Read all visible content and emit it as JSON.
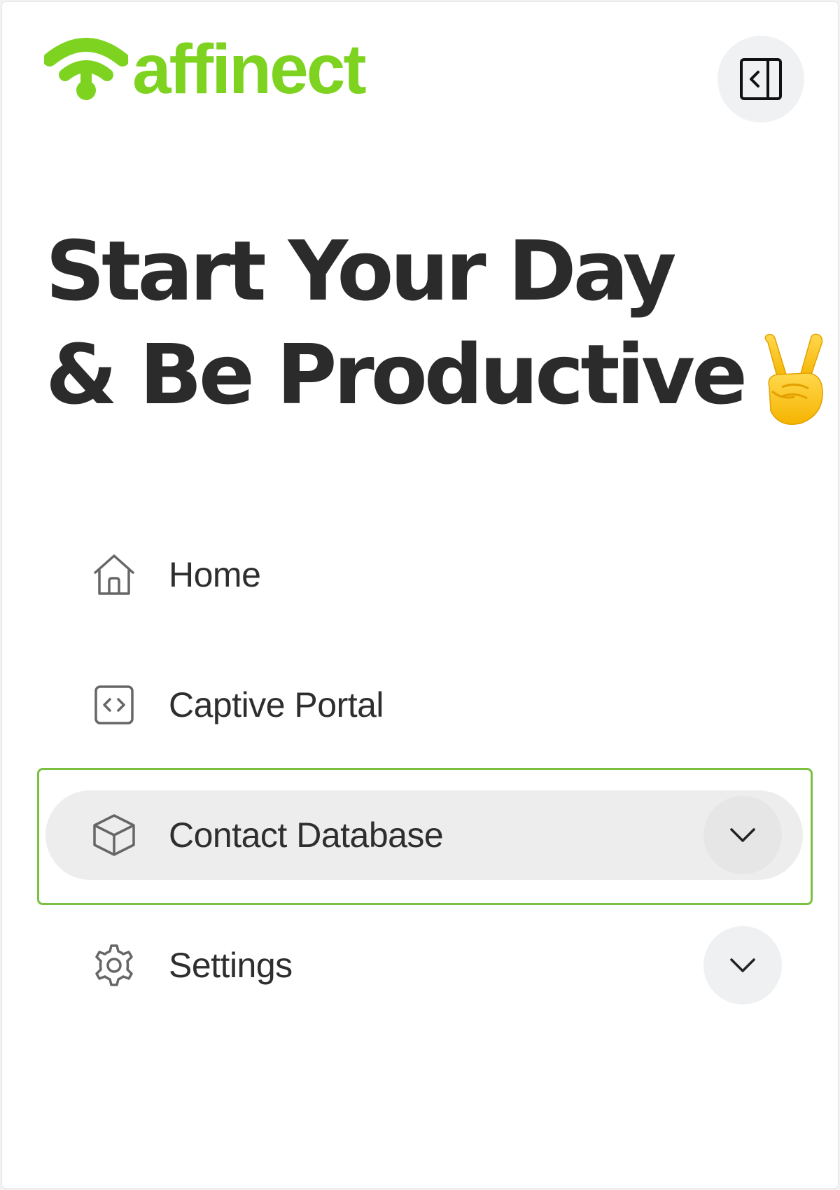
{
  "brand": {
    "name": "affinect",
    "color": "#7ed321",
    "logo_icon": "wifi-signal-logo-icon"
  },
  "header": {
    "collapse_icon": "sidebar-collapse-icon"
  },
  "headline": {
    "line1": "Start Your Day",
    "line2": "& Be Productive",
    "emoji": "✌️"
  },
  "nav": {
    "items": [
      {
        "label": "Home",
        "icon": "home-icon",
        "expandable": false,
        "active": false
      },
      {
        "label": "Captive Portal",
        "icon": "code-icon",
        "expandable": false,
        "active": false
      },
      {
        "label": "Contact Database",
        "icon": "cube-icon",
        "expandable": true,
        "active": true
      },
      {
        "label": "Settings",
        "icon": "gear-icon",
        "expandable": true,
        "active": false
      }
    ]
  },
  "colors": {
    "focus_ring": "#7ac142",
    "active_bg": "#ededed",
    "text": "#2b2b2b"
  }
}
